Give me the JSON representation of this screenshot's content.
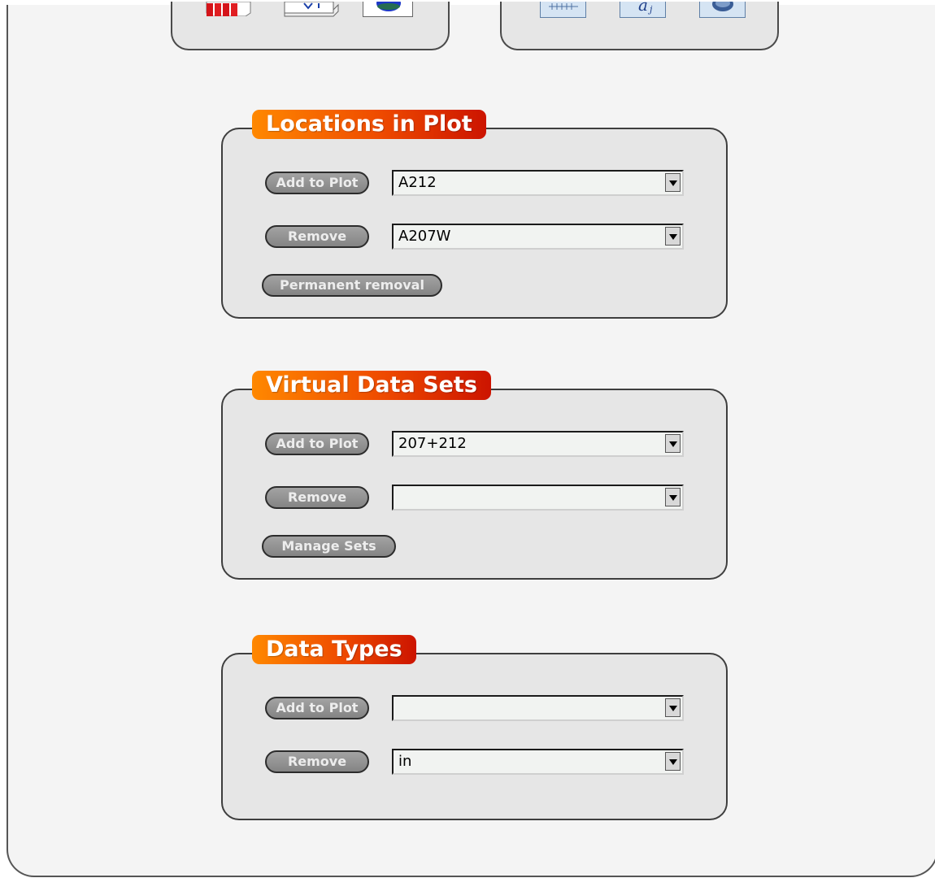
{
  "sections": {
    "locations": {
      "title": "Locations in Plot",
      "add_label": "Add to Plot",
      "add_selected": "A212",
      "remove_label": "Remove",
      "remove_selected": "A207W",
      "permanent_label": "Permanent removal"
    },
    "virtual": {
      "title": "Virtual Data Sets",
      "add_label": "Add to Plot",
      "add_selected": "207+212",
      "remove_label": "Remove",
      "remove_selected": "",
      "manage_label": "Manage Sets"
    },
    "datatypes": {
      "title": "Data Types",
      "add_label": "Add to Plot",
      "add_selected": "",
      "remove_label": "Remove",
      "remove_selected": "in"
    }
  },
  "toolbox_icons": {
    "left": [
      "bar-chart-icon",
      "line-chart-icon",
      "pie-chart-icon"
    ],
    "right": [
      "table-icon",
      "formula-icon",
      "globe-icon"
    ]
  },
  "colors": {
    "legend_gradient": [
      "#ff8800",
      "#cc1400"
    ],
    "button": "#8f8f8f",
    "panel": "#e6e6e6"
  }
}
